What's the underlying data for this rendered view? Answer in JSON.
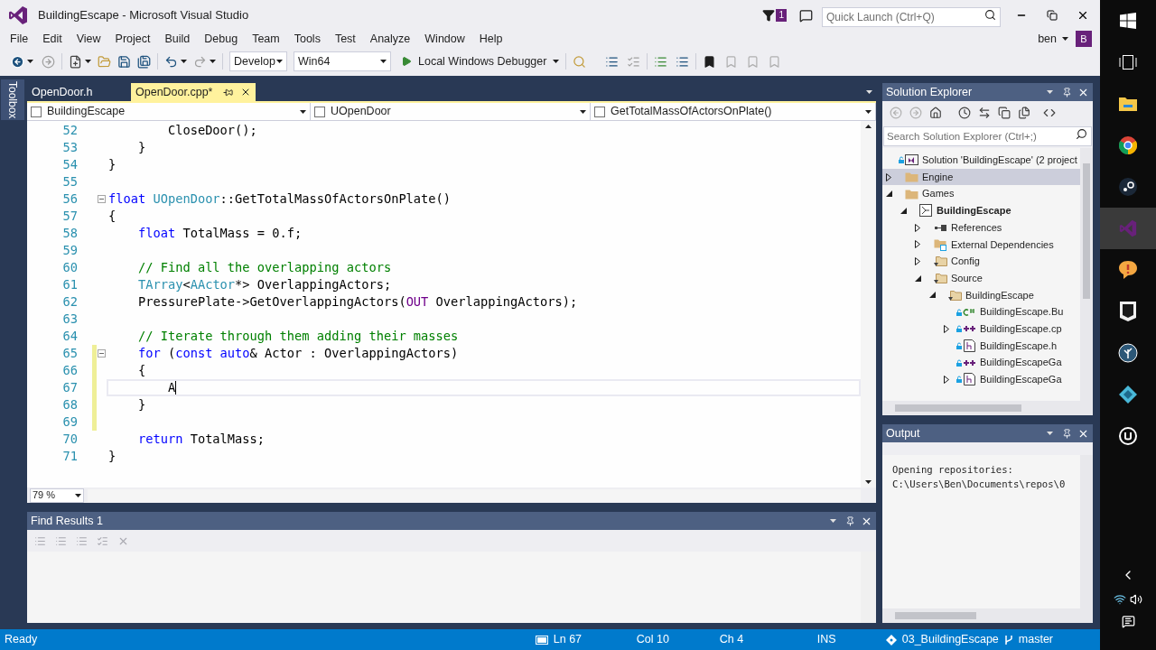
{
  "window": {
    "title": "BuildingEscape - Microsoft Visual Studio"
  },
  "title_bar": {
    "notification_count": "1",
    "quick_launch": {
      "placeholder": "Quick Launch (Ctrl+Q)"
    },
    "user": "ben",
    "avatar": "B"
  },
  "menu": [
    "File",
    "Edit",
    "View",
    "Project",
    "Build",
    "Debug",
    "Team",
    "Tools",
    "Test",
    "Analyze",
    "Window",
    "Help"
  ],
  "toolbar": {
    "configuration": "Develop",
    "platform": "Win64",
    "debugger": "Local Windows Debugger"
  },
  "toolbox_label": "Toolbox",
  "editor": {
    "tabs": [
      {
        "label": "OpenDoor.h",
        "selected": false
      },
      {
        "label": "OpenDoor.cpp*",
        "selected": true
      }
    ],
    "navigation": [
      "BuildingEscape",
      "UOpenDoor",
      "GetTotalMassOfActorsOnPlate()"
    ],
    "lines": [
      {
        "number": "52",
        "modified": false,
        "current": false,
        "foldable": false,
        "tokens": [
          {
            "text": "        CloseDoor();",
            "kind": "plain"
          }
        ]
      },
      {
        "number": "53",
        "modified": false,
        "current": false,
        "foldable": false,
        "tokens": [
          {
            "text": "    }",
            "kind": "plain"
          }
        ]
      },
      {
        "number": "54",
        "modified": false,
        "current": false,
        "foldable": false,
        "tokens": [
          {
            "text": "}",
            "kind": "plain"
          }
        ]
      },
      {
        "number": "55",
        "modified": false,
        "current": false,
        "foldable": false
      },
      {
        "number": "56",
        "modified": false,
        "current": false,
        "foldable": true,
        "tokens": [
          {
            "text": "float",
            "kind": "keyword"
          },
          {
            "text": " UOpenDoor",
            "kind": "type"
          },
          {
            "text": "::GetTotalMassOfActorsOnPlate()",
            "kind": "plain"
          }
        ]
      },
      {
        "number": "57",
        "modified": false,
        "current": false,
        "foldable": false,
        "tokens": [
          {
            "text": "{",
            "kind": "plain"
          }
        ]
      },
      {
        "number": "58",
        "modified": false,
        "current": false,
        "foldable": false,
        "tokens": [
          {
            "text": "    float",
            "kind": "keyword"
          },
          {
            "text": " TotalMass = 0.f;",
            "kind": "plain"
          }
        ]
      },
      {
        "number": "59",
        "modified": false,
        "current": false,
        "foldable": false
      },
      {
        "number": "60",
        "modified": false,
        "current": false,
        "foldable": false,
        "tokens": [
          {
            "text": "    // Find all the overlapping actors",
            "kind": "comment"
          }
        ]
      },
      {
        "number": "61",
        "modified": false,
        "current": false,
        "foldable": false,
        "tokens": [
          {
            "text": "    TArray",
            "kind": "type"
          },
          {
            "text": "<",
            "kind": "plain"
          },
          {
            "text": "AActor",
            "kind": "type"
          },
          {
            "text": "*> OverlappingActors;",
            "kind": "plain"
          }
        ]
      },
      {
        "number": "62",
        "modified": false,
        "current": false,
        "foldable": false,
        "tokens": [
          {
            "text": "    PressurePlate->GetOverlappingActors(",
            "kind": "plain"
          },
          {
            "text": "OUT",
            "kind": "macro"
          },
          {
            "text": " OverlappingActors);",
            "kind": "plain"
          }
        ]
      },
      {
        "number": "63",
        "modified": false,
        "current": false,
        "foldable": false
      },
      {
        "number": "64",
        "modified": false,
        "current": false,
        "foldable": false,
        "tokens": [
          {
            "text": "    // Iterate through them adding their masses",
            "kind": "comment"
          }
        ]
      },
      {
        "number": "65",
        "modified": true,
        "current": false,
        "foldable": true,
        "tokens": [
          {
            "text": "    for",
            "kind": "keyword"
          },
          {
            "text": " (",
            "kind": "plain"
          },
          {
            "text": "const",
            "kind": "keyword"
          },
          {
            "text": " auto",
            "kind": "keyword"
          },
          {
            "text": "& Actor : OverlappingActors)",
            "kind": "plain"
          }
        ]
      },
      {
        "number": "66",
        "modified": true,
        "current": false,
        "foldable": false,
        "tokens": [
          {
            "text": "    {",
            "kind": "plain"
          }
        ]
      },
      {
        "number": "67",
        "modified": true,
        "current": true,
        "foldable": false,
        "tokens": [
          {
            "text": "        A",
            "kind": "plain"
          }
        ]
      },
      {
        "number": "68",
        "modified": true,
        "current": false,
        "foldable": false,
        "tokens": [
          {
            "text": "    }",
            "kind": "plain"
          }
        ]
      },
      {
        "number": "69",
        "modified": true,
        "current": false,
        "foldable": false
      },
      {
        "number": "70",
        "modified": false,
        "current": false,
        "foldable": false,
        "tokens": [
          {
            "text": "    return",
            "kind": "keyword"
          },
          {
            "text": " TotalMass;",
            "kind": "plain"
          }
        ]
      },
      {
        "number": "71",
        "modified": false,
        "current": false,
        "foldable": false,
        "tokens": [
          {
            "text": "}",
            "kind": "plain"
          }
        ]
      }
    ],
    "zoom": "79 %"
  },
  "find_results": {
    "title": "Find Results 1"
  },
  "solution_explorer": {
    "title": "Solution Explorer",
    "search": {
      "placeholder": "Search Solution Explorer (Ctrl+;)"
    },
    "tree": [
      {
        "label": "Solution 'BuildingEscape' (2 project",
        "kind": "solution",
        "locked": true,
        "selected": false
      },
      {
        "label": "Engine",
        "kind": "folder",
        "locked": false,
        "selected": true,
        "expanded": false
      },
      {
        "label": "Games",
        "kind": "folder",
        "locked": false,
        "selected": false,
        "expanded": true,
        "children": [
          {
            "label": "BuildingEscape",
            "kind": "project",
            "locked": false,
            "selected": false,
            "expanded": true,
            "children": [
              {
                "label": "References",
                "kind": "references",
                "locked": false,
                "selected": false,
                "expanded": false
              },
              {
                "label": "External Dependencies",
                "kind": "dependencies",
                "locked": false,
                "selected": false,
                "expanded": false
              },
              {
                "label": "Config",
                "kind": "filter",
                "locked": false,
                "selected": false,
                "expanded": false
              },
              {
                "label": "Source",
                "kind": "filter",
                "locked": false,
                "selected": false,
                "expanded": true,
                "children": [
                  {
                    "label": "BuildingEscape",
                    "kind": "filter",
                    "locked": false,
                    "selected": false,
                    "expanded": true,
                    "children": [
                      {
                        "label": "BuildingEscape.Bu",
                        "kind": "csharp",
                        "locked": true,
                        "selected": false
                      },
                      {
                        "label": "BuildingEscape.cp",
                        "kind": "cpp",
                        "locked": true,
                        "selected": false,
                        "expanded": false
                      },
                      {
                        "label": "BuildingEscape.h",
                        "kind": "header",
                        "locked": true,
                        "selected": false
                      },
                      {
                        "label": "BuildingEscapeGa",
                        "kind": "cpp",
                        "locked": true,
                        "selected": false
                      },
                      {
                        "label": "BuildingEscapeGa",
                        "kind": "header",
                        "locked": true,
                        "selected": false,
                        "expanded": false
                      }
                    ]
                  }
                ]
              }
            ]
          }
        ]
      }
    ]
  },
  "output": {
    "title": "Output",
    "lines": [
      "Opening repositories:",
      "C:\\Users\\Ben\\Documents\\repos\\0"
    ]
  },
  "status_bar": {
    "state": "Ready",
    "line": "Ln 67",
    "column": "Col 10",
    "char": "Ch 4",
    "mode": "INS",
    "repository": "03_BuildingEscape",
    "branch": "master"
  }
}
